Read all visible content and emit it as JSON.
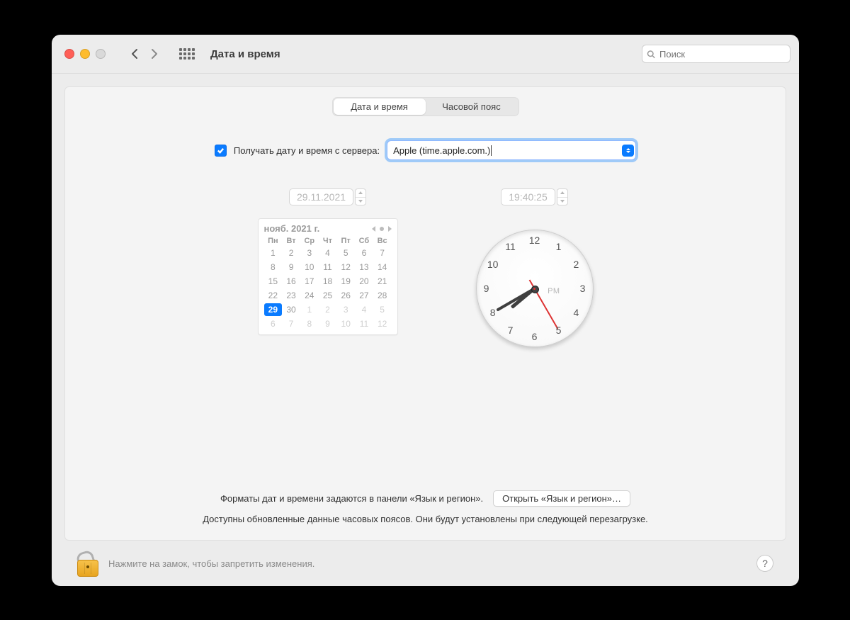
{
  "window": {
    "title": "Дата и время",
    "search_placeholder": "Поиск"
  },
  "tabs": {
    "datetime": "Дата и время",
    "timezone": "Часовой пояс"
  },
  "auto": {
    "label": "Получать дату и время с сервера:",
    "server": "Apple (time.apple.com.)"
  },
  "date": {
    "value": "29.11.2021",
    "month_label": "нояб. 2021 г.",
    "dow": [
      "Пн",
      "Вт",
      "Ср",
      "Чт",
      "Пт",
      "Сб",
      "Вс"
    ],
    "cells": [
      {
        "n": 1
      },
      {
        "n": 2
      },
      {
        "n": 3
      },
      {
        "n": 4
      },
      {
        "n": 5
      },
      {
        "n": 6
      },
      {
        "n": 7
      },
      {
        "n": 8
      },
      {
        "n": 9
      },
      {
        "n": 10
      },
      {
        "n": 11
      },
      {
        "n": 12
      },
      {
        "n": 13
      },
      {
        "n": 14
      },
      {
        "n": 15
      },
      {
        "n": 16
      },
      {
        "n": 17
      },
      {
        "n": 18
      },
      {
        "n": 19
      },
      {
        "n": 20
      },
      {
        "n": 21
      },
      {
        "n": 22
      },
      {
        "n": 23
      },
      {
        "n": 24
      },
      {
        "n": 25
      },
      {
        "n": 26
      },
      {
        "n": 27
      },
      {
        "n": 28
      },
      {
        "n": 29,
        "sel": true
      },
      {
        "n": 30
      },
      {
        "n": 1,
        "other": true
      },
      {
        "n": 2,
        "other": true
      },
      {
        "n": 3,
        "other": true
      },
      {
        "n": 4,
        "other": true
      },
      {
        "n": 5,
        "other": true
      },
      {
        "n": 6,
        "other": true
      },
      {
        "n": 7,
        "other": true
      },
      {
        "n": 8,
        "other": true
      },
      {
        "n": 9,
        "other": true
      },
      {
        "n": 10,
        "other": true
      },
      {
        "n": 11,
        "other": true
      },
      {
        "n": 12,
        "other": true
      }
    ]
  },
  "time": {
    "value": "19:40:25",
    "ampm": "PM",
    "hour": 7,
    "minute": 40,
    "second": 25,
    "numbers": [
      "12",
      "1",
      "2",
      "3",
      "4",
      "5",
      "6",
      "7",
      "8",
      "9",
      "10",
      "11"
    ]
  },
  "bottom": {
    "formats_text": "Форматы дат и времени задаются в панели «Язык и регион».",
    "open_button": "Открыть «Язык и регион»…",
    "tz_update_text": "Доступны обновленные данные часовых поясов. Они будут установлены при следующей перезагрузке."
  },
  "footer": {
    "lock_text": "Нажмите на замок, чтобы запретить изменения.",
    "help": "?"
  }
}
